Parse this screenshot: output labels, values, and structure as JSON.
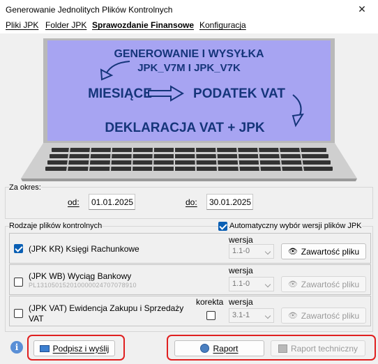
{
  "window": {
    "title": "Generowanie Jednolitych Plików Kontrolnych",
    "close": "✕"
  },
  "menu": [
    "Pliki JPK",
    "Folder JPK",
    "Sprawozdanie Finansowe",
    "Konfiguracja"
  ],
  "banner": {
    "line1": "GENEROWANIE I WYSYŁKA",
    "line2": "JPK_V7M I JPK_V7K",
    "left": "MIESIĄCE",
    "right": "PODATEK VAT",
    "bottom": "DEKLARACJA VAT + JPK"
  },
  "period": {
    "label": "Za okres:",
    "from_label": "od:",
    "from": "01.01.2025",
    "to_label": "do:",
    "to": "30.01.2025"
  },
  "files": {
    "label": "Rodzaje plików kontrolnych",
    "auto_label": "Automatyczny wybór wersji plików JPK",
    "auto_checked": true,
    "version_label": "wersja",
    "korekta_label": "korekta",
    "rows": [
      {
        "name": "(JPK KR) Księgi Rachunkowe",
        "checked": true,
        "version": "1.1-0",
        "button": "Zawartość pliku"
      },
      {
        "name": "(JPK WB) Wyciąg Bankowy",
        "sub": "PL131050152010000024707078910",
        "checked": false,
        "version": "1.1-0",
        "button": "Zawartość pliku"
      },
      {
        "name": "(JPK VAT) Ewidencja Zakupu i Sprzedaży",
        "name2": "VAT",
        "checked": false,
        "version": "3.1-1",
        "button": "Zawartość pliku"
      }
    ]
  },
  "footer": {
    "info": "i",
    "sign": "Podpisz i wyślij",
    "report": "Raport",
    "tech": "Raport techniczny"
  },
  "colors": {
    "accent": "#0a5fb4",
    "highlight": "#e02020",
    "screen": "#a7a4f2",
    "text_blue": "#15357a"
  }
}
